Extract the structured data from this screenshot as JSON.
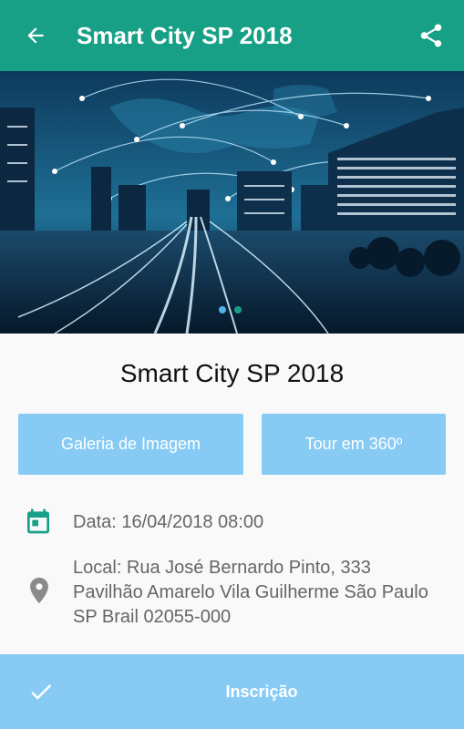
{
  "header": {
    "title": "Smart City SP 2018",
    "back_icon": "arrow-back-icon",
    "share_icon": "share-icon"
  },
  "hero": {
    "slide_count": 2,
    "active_index": 0
  },
  "event": {
    "title": "Smart City SP 2018",
    "gallery_label": "Galeria de Imagem",
    "tour_label": "Tour em 360º",
    "date_text": "Data: 16/04/2018 08:00",
    "location_text": "Local: Rua José Bernardo Pinto, 333 Pavilhão Amarelo Vila Guilherme São Paulo SP Brail 02055-000",
    "date_icon": "calendar-icon",
    "location_icon": "location-pin-icon"
  },
  "footer": {
    "label": "Inscrição",
    "icon": "check-icon"
  },
  "colors": {
    "appbar": "#17a086",
    "button": "#87cbf5",
    "icon_gray": "#8a8a8a"
  }
}
